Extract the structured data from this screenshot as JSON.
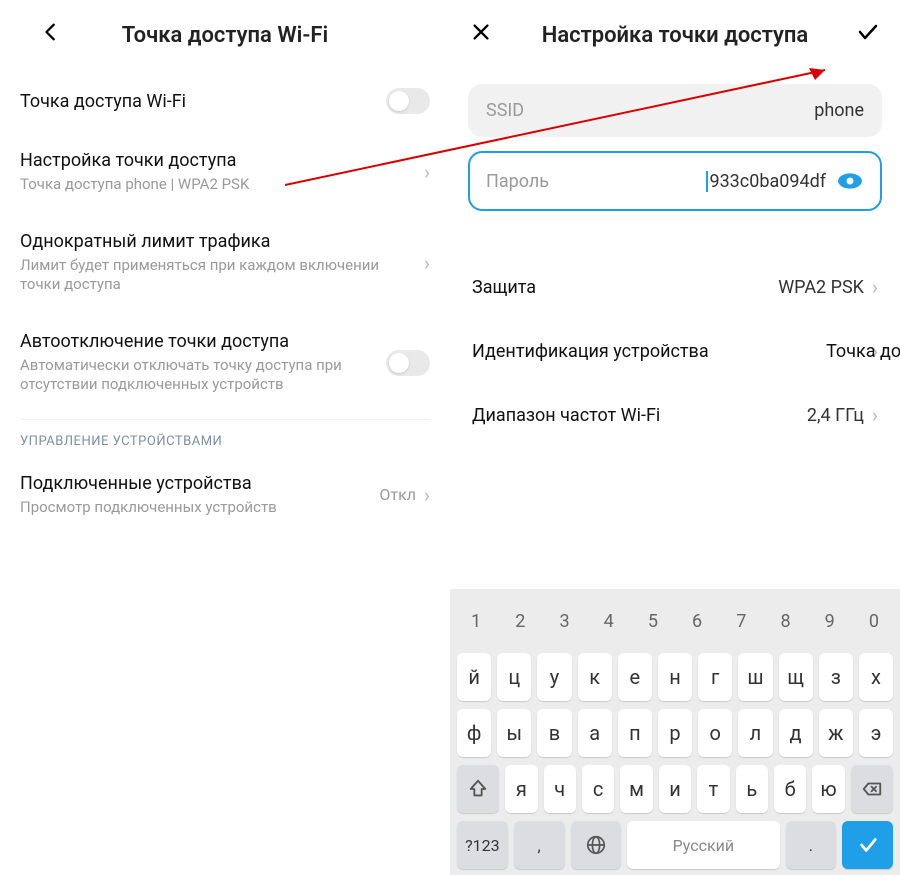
{
  "left": {
    "title": "Точка доступа Wi-Fi",
    "rows": {
      "hotspot_toggle": "Точка доступа Wi-Fi",
      "setup_title": "Настройка точки доступа",
      "setup_sub": "Точка доступа phone | WPA2 PSK",
      "limit_title": "Однократный лимит трафика",
      "limit_sub": "Лимит будет применяться при каждом включении точки доступа",
      "auto_off_title": "Автоотключение точки доступа",
      "auto_off_sub": "Автоматически отключать точку доступа при отсутствии подключенных устройств",
      "section": "УПРАВЛЕНИЕ УСТРОЙСТВАМИ",
      "devices_title": "Подключенные устройства",
      "devices_sub": "Просмотр подключенных устройств",
      "devices_value": "Откл"
    }
  },
  "right": {
    "title": "Настройка точки доступа",
    "ssid_label": "SSID",
    "ssid_value": "phone",
    "pwd_label": "Пароль",
    "pwd_value": "933c0ba094df",
    "security_label": "Защита",
    "security_value": "WPA2 PSK",
    "ident_label": "Идентификация устройства",
    "ident_value": "Точка доступа",
    "band_label": "Диапазон частот Wi-Fi",
    "band_value": "2,4 ГГц"
  },
  "keyboard": {
    "nums": [
      "1",
      "2",
      "3",
      "4",
      "5",
      "6",
      "7",
      "8",
      "9",
      "0"
    ],
    "r1": [
      "й",
      "ц",
      "у",
      "к",
      "е",
      "н",
      "г",
      "ш",
      "щ",
      "з",
      "х"
    ],
    "r2": [
      "ф",
      "ы",
      "в",
      "а",
      "п",
      "р",
      "о",
      "л",
      "д",
      "ж",
      "э"
    ],
    "r3": [
      "я",
      "ч",
      "с",
      "м",
      "и",
      "т",
      "ь",
      "б",
      "ю"
    ],
    "sym": "?123",
    "comma": ",",
    "space": "Русский",
    "period": "."
  }
}
